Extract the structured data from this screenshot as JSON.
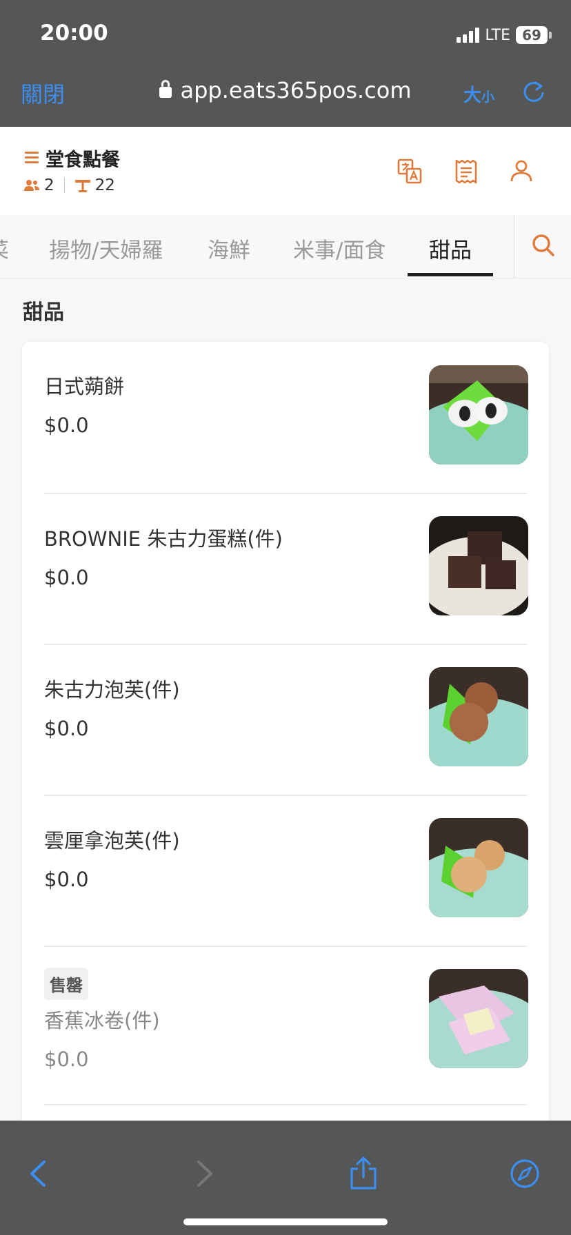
{
  "status_bar": {
    "time": "20:00",
    "network": "LTE",
    "battery": "69"
  },
  "browser": {
    "close_label": "關閉",
    "url": "app.eats365pos.com",
    "text_size_big": "大",
    "text_size_small": "小"
  },
  "header": {
    "title": "堂食點餐",
    "guests": "2",
    "table": "22"
  },
  "tabs": [
    "菜",
    "揚物/天婦羅",
    "海鮮",
    "米事/面食",
    "甜品"
  ],
  "active_tab": "甜品",
  "section_title": "甜品",
  "items": [
    {
      "name": "日式蒴餅",
      "price": "$0.0",
      "sold_out": false
    },
    {
      "name": "BROWNIE 朱古力蛋糕(件)",
      "price": "$0.0",
      "sold_out": false
    },
    {
      "name": "朱古力泡芙(件)",
      "price": "$0.0",
      "sold_out": false
    },
    {
      "name": "雲厘拿泡芙(件)",
      "price": "$0.0",
      "sold_out": false
    },
    {
      "name": "香蕉冰卷(件)",
      "price": "$0.0",
      "sold_out": true,
      "badge": "售罄"
    }
  ],
  "colors": {
    "accent": "#e07a3a",
    "browser_blue": "#3d8ef2",
    "browser_bar": "#555757"
  },
  "icons": [
    "menu-icon",
    "people-icon",
    "table-icon",
    "translate-icon",
    "receipt-icon",
    "user-icon",
    "search-icon",
    "lock-icon",
    "reload-icon",
    "back-icon",
    "forward-icon",
    "share-icon",
    "compass-icon"
  ]
}
